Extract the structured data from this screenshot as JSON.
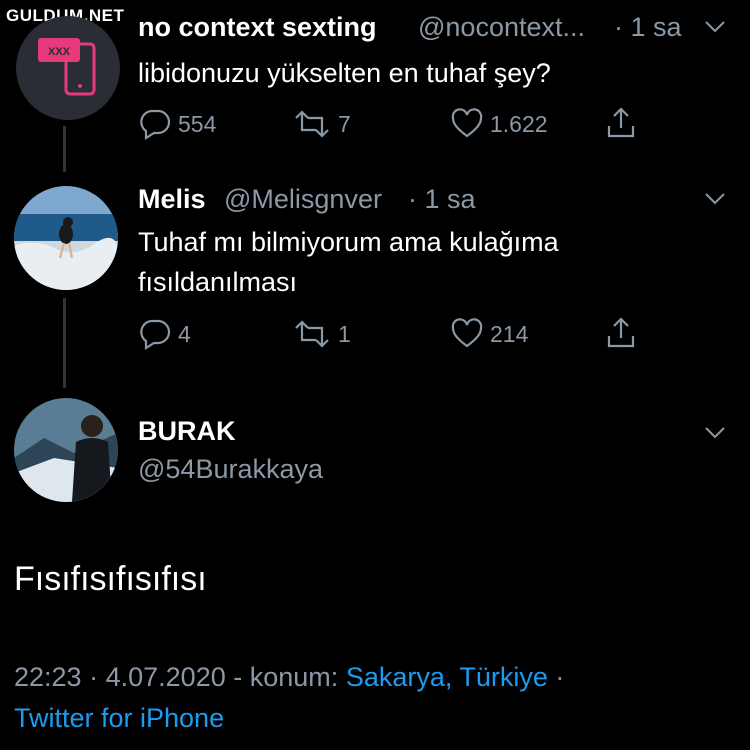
{
  "watermark": "GULDUM.NET",
  "tweet1": {
    "name": "no context sexting",
    "handle": "@nocontext...",
    "time": "· 1 sa",
    "text": "libidonuzu yükselten en tuhaf şey?",
    "avatar_label": "XXX",
    "replies": "554",
    "retweets": "7",
    "likes": "1.622"
  },
  "tweet2": {
    "name": "Melis",
    "handle": "@Melisgnver",
    "time": "· 1 sa",
    "text_line1": "Tuhaf mı bilmiyorum ama kulağıma",
    "text_line2": "fısıldanılması",
    "replies": "4",
    "retweets": "1",
    "likes": "214"
  },
  "tweet3": {
    "name": "BURAK",
    "handle": "@54Burakkaya",
    "text": "Fısıfısıfısıfısı",
    "time": "22:23",
    "date": "4.07.2020",
    "location_label": "- konum:",
    "location": "Sakarya, Türkiye",
    "source": "Twitter for iPhone"
  },
  "colors": {
    "accent": "#1d9bf0",
    "secondary": "#8b98a5",
    "background": "#000000"
  }
}
